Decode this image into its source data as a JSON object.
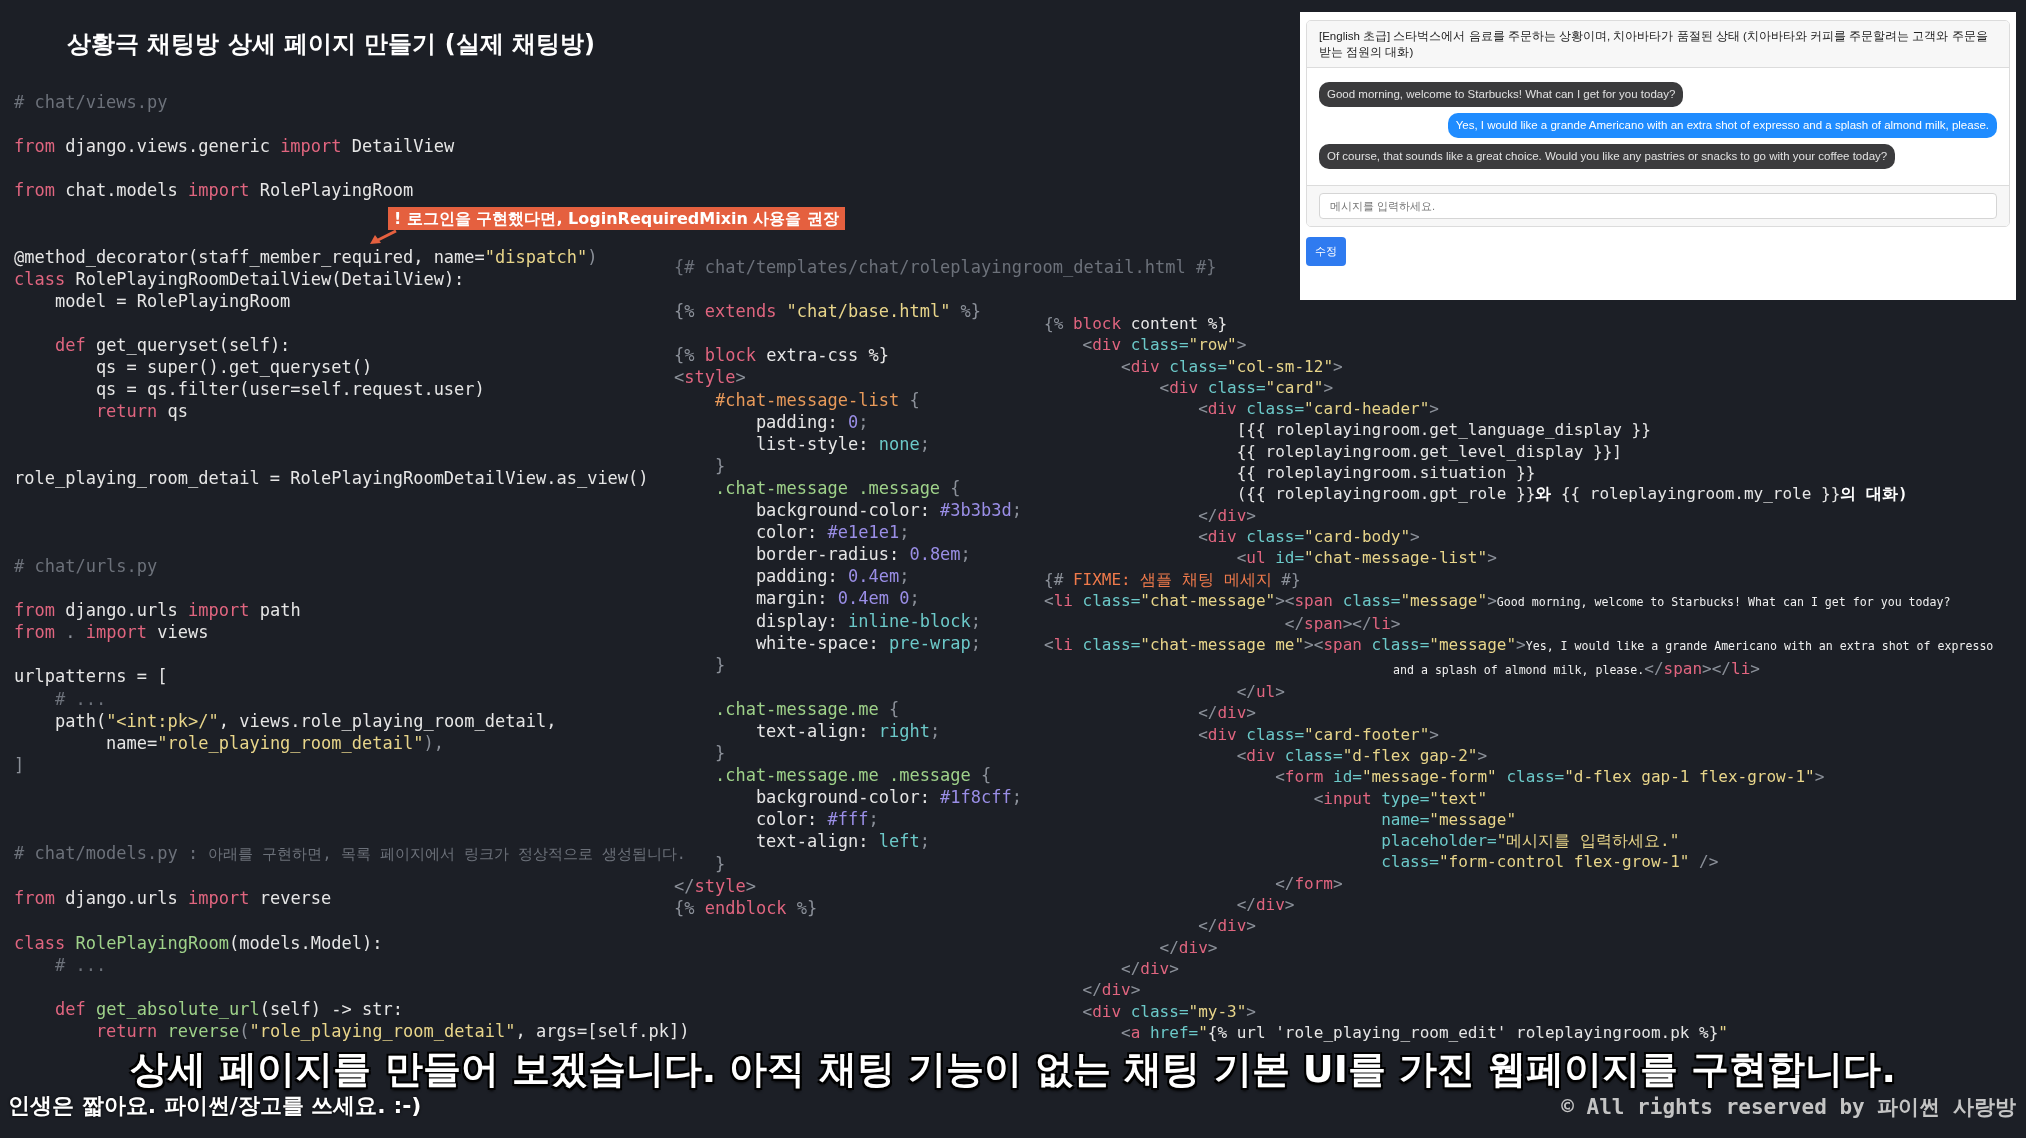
{
  "title": "상황극 채팅방 상세 페이지 만들기 (실제 채팅방)",
  "code_panes": [
    {
      "lines": [
        {
          "kind": "code",
          "tokens": [
            {
              "t": "# chat/views.py",
              "kind": "comment"
            }
          ]
        },
        {
          "kind": "blank"
        },
        {
          "kind": "code",
          "tokens": [
            {
              "t": "from",
              "kind": "keyword"
            },
            {
              "t": " django.views.generic ",
              "kind": "plain"
            },
            {
              "t": "import",
              "kind": "keyword"
            },
            {
              "t": " DetailView",
              "kind": "plain"
            }
          ]
        },
        {
          "kind": "blank"
        },
        {
          "kind": "code",
          "tokens": [
            {
              "t": "from",
              "kind": "keyword"
            },
            {
              "t": " chat.models ",
              "kind": "plain"
            },
            {
              "t": "import",
              "kind": "keyword"
            },
            {
              "t": " RolePlayingRoom",
              "kind": "plain"
            }
          ]
        },
        {
          "kind": "blank"
        },
        {
          "kind": "blank"
        },
        {
          "kind": "code",
          "tokens": [
            {
              "t": "@method_decorator(staff_member_required, name=",
              "kind": "plain"
            },
            {
              "t": "\"dispatch\"",
              "kind": "string"
            },
            {
              "t": ")",
              "kind": "punct"
            }
          ]
        },
        {
          "kind": "code",
          "tokens": [
            {
              "t": "class",
              "kind": "keyword"
            },
            {
              "t": " RolePlayingRoomDetailView(DetailView):",
              "kind": "plain"
            }
          ]
        },
        {
          "kind": "code",
          "tokens": [
            {
              "t": "    model = RolePlayingRoom",
              "kind": "plain"
            }
          ]
        },
        {
          "kind": "blank"
        },
        {
          "kind": "code",
          "tokens": [
            {
              "t": "    def",
              "kind": "keyword"
            },
            {
              "t": " get_queryset(self):",
              "kind": "plain"
            }
          ]
        },
        {
          "kind": "code",
          "tokens": [
            {
              "t": "        qs = super().get_queryset()",
              "kind": "plain"
            }
          ]
        },
        {
          "kind": "code",
          "tokens": [
            {
              "t": "        qs = qs.filter(user=self.request.user)",
              "kind": "plain"
            }
          ]
        },
        {
          "kind": "code",
          "tokens": [
            {
              "t": "        return",
              "kind": "keyword"
            },
            {
              "t": " qs",
              "kind": "plain"
            }
          ]
        },
        {
          "kind": "blank"
        },
        {
          "kind": "blank"
        },
        {
          "kind": "code",
          "tokens": [
            {
              "t": "role_playing_room_detail = RolePlayingRoomDetailView.as_view()",
              "kind": "plain"
            }
          ]
        },
        {
          "kind": "blank"
        },
        {
          "kind": "blank"
        },
        {
          "kind": "blank"
        },
        {
          "kind": "code",
          "tokens": [
            {
              "t": "# chat/urls.py",
              "kind": "comment"
            }
          ]
        },
        {
          "kind": "blank"
        },
        {
          "kind": "code",
          "tokens": [
            {
              "t": "from",
              "kind": "keyword"
            },
            {
              "t": " django.urls ",
              "kind": "plain"
            },
            {
              "t": "import",
              "kind": "keyword"
            },
            {
              "t": " path",
              "kind": "plain"
            }
          ]
        },
        {
          "kind": "code",
          "tokens": [
            {
              "t": "from",
              "kind": "keyword"
            },
            {
              "t": " . ",
              "kind": "punct"
            },
            {
              "t": "import",
              "kind": "keyword"
            },
            {
              "t": " views",
              "kind": "plain"
            }
          ]
        },
        {
          "kind": "blank"
        },
        {
          "kind": "code",
          "tokens": [
            {
              "t": "urlpatterns = [",
              "kind": "plain"
            }
          ]
        },
        {
          "kind": "code",
          "tokens": [
            {
              "t": "    # ...",
              "kind": "comment"
            }
          ]
        },
        {
          "kind": "code",
          "tokens": [
            {
              "t": "    path(",
              "kind": "plain"
            },
            {
              "t": "\"<int:pk>/\"",
              "kind": "string"
            },
            {
              "t": ", views.role_playing_room_detail,",
              "kind": "plain"
            }
          ]
        },
        {
          "kind": "code",
          "tokens": [
            {
              "t": "         name=",
              "kind": "plain"
            },
            {
              "t": "\"role_playing_room_detail\"",
              "kind": "string"
            },
            {
              "t": "),",
              "kind": "punct"
            }
          ]
        },
        {
          "kind": "code",
          "tokens": [
            {
              "t": "]",
              "kind": "punct"
            }
          ]
        },
        {
          "kind": "blank"
        },
        {
          "kind": "blank"
        },
        {
          "kind": "blank"
        },
        {
          "kind": "code",
          "tokens": [
            {
              "t": "# chat/models.py : ",
              "kind": "comment"
            },
            {
              "t": "아래를 구현하면, 목록 페이지에서 링크가 정상적으로 생성됩니다.",
              "kind": "comment-hangul"
            }
          ]
        },
        {
          "kind": "blank"
        },
        {
          "kind": "code",
          "tokens": [
            {
              "t": "from",
              "kind": "keyword"
            },
            {
              "t": " django.urls ",
              "kind": "plain"
            },
            {
              "t": "import",
              "kind": "keyword"
            },
            {
              "t": " reverse",
              "kind": "plain"
            }
          ]
        },
        {
          "kind": "blank"
        },
        {
          "kind": "code",
          "tokens": [
            {
              "t": "class",
              "kind": "keyword"
            },
            {
              "t": " RolePlayingRoom",
              "kind": "name"
            },
            {
              "t": "(models.Model):",
              "kind": "plain"
            }
          ]
        },
        {
          "kind": "code",
          "tokens": [
            {
              "t": "    # ...",
              "kind": "comment"
            }
          ]
        },
        {
          "kind": "blank"
        },
        {
          "kind": "code",
          "tokens": [
            {
              "t": "    def",
              "kind": "keyword"
            },
            {
              "t": " get_absolute_url",
              "kind": "name"
            },
            {
              "t": "(self) -> str:",
              "kind": "plain"
            }
          ]
        },
        {
          "kind": "code",
          "tokens": [
            {
              "t": "        return",
              "kind": "keyword"
            },
            {
              "t": " reverse",
              "kind": "name"
            },
            {
              "t": "(",
              "kind": "punct"
            },
            {
              "t": "\"role_playing_room_detail\"",
              "kind": "string"
            },
            {
              "t": ", args=[self.pk])",
              "kind": "plain"
            }
          ]
        }
      ]
    },
    {
      "lines": [
        {
          "kind": "code",
          "tokens": [
            {
              "t": "{# chat/templates/chat/roleplayingroom_detail.html #}",
              "kind": "comment"
            }
          ]
        },
        {
          "kind": "blank"
        },
        {
          "kind": "code",
          "tokens": [
            {
              "t": "{% ",
              "kind": "punct"
            },
            {
              "t": "extends",
              "kind": "keyword"
            },
            {
              "t": " \"chat/base.html\"",
              "kind": "string"
            },
            {
              "t": " %}",
              "kind": "punct"
            }
          ]
        },
        {
          "kind": "blank"
        },
        {
          "kind": "code",
          "tokens": [
            {
              "t": "{% ",
              "kind": "punct"
            },
            {
              "t": "block",
              "kind": "keyword"
            },
            {
              "t": " extra-css %}",
              "kind": "plain"
            }
          ]
        },
        {
          "kind": "code",
          "tokens": [
            {
              "t": "<",
              "kind": "punct"
            },
            {
              "t": "style",
              "kind": "keyword"
            },
            {
              "t": ">",
              "kind": "punct"
            }
          ]
        },
        {
          "kind": "code",
          "tokens": [
            {
              "t": "    #chat-message-list",
              "kind": "selector"
            },
            {
              "t": " {",
              "kind": "punct"
            }
          ]
        },
        {
          "kind": "code",
          "tokens": [
            {
              "t": "        padding: ",
              "kind": "plain"
            },
            {
              "t": "0",
              "kind": "number"
            },
            {
              "t": ";",
              "kind": "punct"
            }
          ]
        },
        {
          "kind": "code",
          "tokens": [
            {
              "t": "        list-style: ",
              "kind": "plain"
            },
            {
              "t": "none",
              "kind": "value"
            },
            {
              "t": ";",
              "kind": "punct"
            }
          ]
        },
        {
          "kind": "code",
          "tokens": [
            {
              "t": "    }",
              "kind": "punct"
            }
          ]
        },
        {
          "kind": "code",
          "tokens": [
            {
              "t": "    .chat-message .message",
              "kind": "name"
            },
            {
              "t": " {",
              "kind": "punct"
            }
          ]
        },
        {
          "kind": "code",
          "tokens": [
            {
              "t": "        background-color: ",
              "kind": "plain"
            },
            {
              "t": "#3b3b3d",
              "kind": "number"
            },
            {
              "t": ";",
              "kind": "punct"
            }
          ]
        },
        {
          "kind": "code",
          "tokens": [
            {
              "t": "        color: ",
              "kind": "plain"
            },
            {
              "t": "#e1e1e1",
              "kind": "number"
            },
            {
              "t": ";",
              "kind": "punct"
            }
          ]
        },
        {
          "kind": "code",
          "tokens": [
            {
              "t": "        border-radius: ",
              "kind": "plain"
            },
            {
              "t": "0.8em",
              "kind": "number"
            },
            {
              "t": ";",
              "kind": "punct"
            }
          ]
        },
        {
          "kind": "code",
          "tokens": [
            {
              "t": "        padding: ",
              "kind": "plain"
            },
            {
              "t": "0.4em",
              "kind": "number"
            },
            {
              "t": ";",
              "kind": "punct"
            }
          ]
        },
        {
          "kind": "code",
          "tokens": [
            {
              "t": "        margin: ",
              "kind": "plain"
            },
            {
              "t": "0.4em 0",
              "kind": "number"
            },
            {
              "t": ";",
              "kind": "punct"
            }
          ]
        },
        {
          "kind": "code",
          "tokens": [
            {
              "t": "        display: ",
              "kind": "plain"
            },
            {
              "t": "inline-block",
              "kind": "value"
            },
            {
              "t": ";",
              "kind": "punct"
            }
          ]
        },
        {
          "kind": "code",
          "tokens": [
            {
              "t": "        white-space: ",
              "kind": "plain"
            },
            {
              "t": "pre-wrap",
              "kind": "value"
            },
            {
              "t": ";",
              "kind": "punct"
            }
          ]
        },
        {
          "kind": "code",
          "tokens": [
            {
              "t": "    }",
              "kind": "punct"
            }
          ]
        },
        {
          "kind": "blank"
        },
        {
          "kind": "code",
          "tokens": [
            {
              "t": "    .chat-message.me",
              "kind": "name"
            },
            {
              "t": " {",
              "kind": "punct"
            }
          ]
        },
        {
          "kind": "code",
          "tokens": [
            {
              "t": "        text-align: ",
              "kind": "plain"
            },
            {
              "t": "right",
              "kind": "value"
            },
            {
              "t": ";",
              "kind": "punct"
            }
          ]
        },
        {
          "kind": "code",
          "tokens": [
            {
              "t": "    }",
              "kind": "punct"
            }
          ]
        },
        {
          "kind": "code",
          "tokens": [
            {
              "t": "    .chat-message.me .message",
              "kind": "name"
            },
            {
              "t": " {",
              "kind": "punct"
            }
          ]
        },
        {
          "kind": "code",
          "tokens": [
            {
              "t": "        background-color: ",
              "kind": "plain"
            },
            {
              "t": "#1f8cff",
              "kind": "number"
            },
            {
              "t": ";",
              "kind": "punct"
            }
          ]
        },
        {
          "kind": "code",
          "tokens": [
            {
              "t": "        color: ",
              "kind": "plain"
            },
            {
              "t": "#fff",
              "kind": "number"
            },
            {
              "t": ";",
              "kind": "punct"
            }
          ]
        },
        {
          "kind": "code",
          "tokens": [
            {
              "t": "        text-align: ",
              "kind": "plain"
            },
            {
              "t": "left",
              "kind": "value"
            },
            {
              "t": ";",
              "kind": "punct"
            }
          ]
        },
        {
          "kind": "code",
          "tokens": [
            {
              "t": "    }",
              "kind": "punct"
            }
          ]
        },
        {
          "kind": "code",
          "tokens": [
            {
              "t": "</",
              "kind": "punct"
            },
            {
              "t": "style",
              "kind": "keyword"
            },
            {
              "t": ">",
              "kind": "punct"
            }
          ]
        },
        {
          "kind": "code",
          "tokens": [
            {
              "t": "{% ",
              "kind": "punct"
            },
            {
              "t": "endblock",
              "kind": "keyword"
            },
            {
              "t": " %}",
              "kind": "punct"
            }
          ]
        }
      ]
    },
    {
      "lines": [
        {
          "kind": "code",
          "tokens": [
            {
              "t": "{% ",
              "kind": "punct"
            },
            {
              "t": "block",
              "kind": "keyword"
            },
            {
              "t": " content %}",
              "kind": "plain"
            }
          ]
        },
        {
          "kind": "code",
          "tokens": [
            {
              "t": "    <",
              "kind": "punct"
            },
            {
              "t": "div",
              "kind": "keyword"
            },
            {
              "t": " class=",
              "kind": "value"
            },
            {
              "t": "\"row\"",
              "kind": "string"
            },
            {
              "t": ">",
              "kind": "punct"
            }
          ]
        },
        {
          "kind": "code",
          "tokens": [
            {
              "t": "        <",
              "kind": "punct"
            },
            {
              "t": "div",
              "kind": "keyword"
            },
            {
              "t": " class=",
              "kind": "value"
            },
            {
              "t": "\"col-sm-12\"",
              "kind": "string"
            },
            {
              "t": ">",
              "kind": "punct"
            }
          ]
        },
        {
          "kind": "code",
          "tokens": [
            {
              "t": "            <",
              "kind": "punct"
            },
            {
              "t": "div",
              "kind": "keyword"
            },
            {
              "t": " class=",
              "kind": "value"
            },
            {
              "t": "\"card\"",
              "kind": "string"
            },
            {
              "t": ">",
              "kind": "punct"
            }
          ]
        },
        {
          "kind": "code",
          "tokens": [
            {
              "t": "                <",
              "kind": "punct"
            },
            {
              "t": "div",
              "kind": "keyword"
            },
            {
              "t": " class=",
              "kind": "value"
            },
            {
              "t": "\"card-header\"",
              "kind": "string"
            },
            {
              "t": ">",
              "kind": "punct"
            }
          ]
        },
        {
          "kind": "code",
          "tokens": [
            {
              "t": "                    [{{ roleplayingroom.get_language_display }}",
              "kind": "plain"
            }
          ]
        },
        {
          "kind": "code",
          "tokens": [
            {
              "t": "                    {{ roleplayingroom.get_level_display }}]",
              "kind": "plain"
            }
          ]
        },
        {
          "kind": "code",
          "tokens": [
            {
              "t": "                    {{ roleplayingroom.situation }}",
              "kind": "plain"
            }
          ]
        },
        {
          "kind": "code",
          "tokens": [
            {
              "t": "                    ({{ roleplayingroom.gpt_role }}",
              "kind": "plain"
            },
            {
              "t": "와 ",
              "kind": "hangul"
            },
            {
              "t": "{{ roleplayingroom.my_role }}",
              "kind": "plain"
            },
            {
              "t": "의 대화)",
              "kind": "hangul"
            }
          ]
        },
        {
          "kind": "code",
          "tokens": [
            {
              "t": "                </",
              "kind": "punct"
            },
            {
              "t": "div",
              "kind": "keyword"
            },
            {
              "t": ">",
              "kind": "punct"
            }
          ]
        },
        {
          "kind": "code",
          "tokens": [
            {
              "t": "                <",
              "kind": "punct"
            },
            {
              "t": "div",
              "kind": "keyword"
            },
            {
              "t": " class=",
              "kind": "value"
            },
            {
              "t": "\"card-body\"",
              "kind": "string"
            },
            {
              "t": ">",
              "kind": "punct"
            }
          ]
        },
        {
          "kind": "code",
          "tokens": [
            {
              "t": "                    <",
              "kind": "punct"
            },
            {
              "t": "ul",
              "kind": "keyword"
            },
            {
              "t": " id=",
              "kind": "value"
            },
            {
              "t": "\"chat-message-list\"",
              "kind": "string"
            },
            {
              "t": ">",
              "kind": "punct"
            }
          ]
        },
        {
          "kind": "code",
          "tokens": [
            {
              "t": "{# ",
              "kind": "punct"
            },
            {
              "t": "FIXME: 샘플 채팅 메세지",
              "kind": "fixme"
            },
            {
              "t": " #}",
              "kind": "punct"
            }
          ]
        },
        {
          "kind": "code",
          "tokens": [
            {
              "t": "<",
              "kind": "punct"
            },
            {
              "t": "li",
              "kind": "keyword"
            },
            {
              "t": " class=",
              "kind": "value"
            },
            {
              "t": "\"chat-message\"",
              "kind": "string"
            },
            {
              "t": "><",
              "kind": "punct"
            },
            {
              "t": "span",
              "kind": "keyword"
            },
            {
              "t": " class=",
              "kind": "value"
            },
            {
              "t": "\"message\"",
              "kind": "string"
            },
            {
              "t": ">",
              "kind": "punct"
            },
            {
              "t": "Good morning, welcome to Starbucks! What can I get for you today?",
              "kind": "message"
            }
          ]
        },
        {
          "kind": "code",
          "tokens": [
            {
              "t": "                         </",
              "kind": "punct"
            },
            {
              "t": "span",
              "kind": "keyword"
            },
            {
              "t": "></",
              "kind": "punct"
            },
            {
              "t": "li",
              "kind": "keyword"
            },
            {
              "t": ">",
              "kind": "punct"
            }
          ]
        },
        {
          "kind": "code",
          "tokens": [
            {
              "t": "<",
              "kind": "punct"
            },
            {
              "t": "li",
              "kind": "keyword"
            },
            {
              "t": " class=",
              "kind": "value"
            },
            {
              "t": "\"chat-message me\"",
              "kind": "string"
            },
            {
              "t": "><",
              "kind": "punct"
            },
            {
              "t": "span",
              "kind": "keyword"
            },
            {
              "t": " class=",
              "kind": "value"
            },
            {
              "t": "\"message\"",
              "kind": "string"
            },
            {
              "t": ">",
              "kind": "punct"
            },
            {
              "t": "Yes, I would like a grande Americano with an extra shot of expresso",
              "kind": "message"
            }
          ]
        },
        {
          "kind": "code",
          "tokens": [
            {
              "t": "                                                  and a splash of almond milk, please.",
              "kind": "message-indented"
            },
            {
              "t": "</",
              "kind": "punct"
            },
            {
              "t": "span",
              "kind": "keyword"
            },
            {
              "t": "></",
              "kind": "punct"
            },
            {
              "t": "li",
              "kind": "keyword"
            },
            {
              "t": ">",
              "kind": "punct"
            }
          ]
        },
        {
          "kind": "code",
          "tokens": [
            {
              "t": "                    </",
              "kind": "punct"
            },
            {
              "t": "ul",
              "kind": "keyword"
            },
            {
              "t": ">",
              "kind": "punct"
            }
          ]
        },
        {
          "kind": "code",
          "tokens": [
            {
              "t": "                </",
              "kind": "punct"
            },
            {
              "t": "div",
              "kind": "keyword"
            },
            {
              "t": ">",
              "kind": "punct"
            }
          ]
        },
        {
          "kind": "code",
          "tokens": [
            {
              "t": "                <",
              "kind": "punct"
            },
            {
              "t": "div",
              "kind": "keyword"
            },
            {
              "t": " class=",
              "kind": "value"
            },
            {
              "t": "\"card-footer\"",
              "kind": "string"
            },
            {
              "t": ">",
              "kind": "punct"
            }
          ]
        },
        {
          "kind": "code",
          "tokens": [
            {
              "t": "                    <",
              "kind": "punct"
            },
            {
              "t": "div",
              "kind": "keyword"
            },
            {
              "t": " class=",
              "kind": "value"
            },
            {
              "t": "\"d-flex gap-2\"",
              "kind": "string"
            },
            {
              "t": ">",
              "kind": "punct"
            }
          ]
        },
        {
          "kind": "code",
          "tokens": [
            {
              "t": "                        <",
              "kind": "punct"
            },
            {
              "t": "form",
              "kind": "keyword"
            },
            {
              "t": " id=",
              "kind": "value"
            },
            {
              "t": "\"message-form\"",
              "kind": "string"
            },
            {
              "t": " class=",
              "kind": "value"
            },
            {
              "t": "\"d-flex gap-1 flex-grow-1\"",
              "kind": "string"
            },
            {
              "t": ">",
              "kind": "punct"
            }
          ]
        },
        {
          "kind": "code",
          "tokens": [
            {
              "t": "                            <",
              "kind": "punct"
            },
            {
              "t": "input",
              "kind": "keyword"
            },
            {
              "t": " type=",
              "kind": "value"
            },
            {
              "t": "\"text\"",
              "kind": "string"
            }
          ]
        },
        {
          "kind": "code",
          "tokens": [
            {
              "t": "                                   name=",
              "kind": "value"
            },
            {
              "t": "\"message\"",
              "kind": "string"
            }
          ]
        },
        {
          "kind": "code",
          "tokens": [
            {
              "t": "                                   placeholder=",
              "kind": "value"
            },
            {
              "t": "\"메시지를 입력하세요.\"",
              "kind": "string"
            }
          ]
        },
        {
          "kind": "code",
          "tokens": [
            {
              "t": "                                   class=",
              "kind": "value"
            },
            {
              "t": "\"form-control flex-grow-1\"",
              "kind": "string"
            },
            {
              "t": " />",
              "kind": "punct"
            }
          ]
        },
        {
          "kind": "code",
          "tokens": [
            {
              "t": "                        </",
              "kind": "punct"
            },
            {
              "t": "form",
              "kind": "keyword"
            },
            {
              "t": ">",
              "kind": "punct"
            }
          ]
        },
        {
          "kind": "code",
          "tokens": [
            {
              "t": "                    </",
              "kind": "punct"
            },
            {
              "t": "div",
              "kind": "keyword"
            },
            {
              "t": ">",
              "kind": "punct"
            }
          ]
        },
        {
          "kind": "code",
          "tokens": [
            {
              "t": "                </",
              "kind": "punct"
            },
            {
              "t": "div",
              "kind": "keyword"
            },
            {
              "t": ">",
              "kind": "punct"
            }
          ]
        },
        {
          "kind": "code",
          "tokens": [
            {
              "t": "            </",
              "kind": "punct"
            },
            {
              "t": "div",
              "kind": "keyword"
            },
            {
              "t": ">",
              "kind": "punct"
            }
          ]
        },
        {
          "kind": "code",
          "tokens": [
            {
              "t": "        </",
              "kind": "punct"
            },
            {
              "t": "div",
              "kind": "keyword"
            },
            {
              "t": ">",
              "kind": "punct"
            }
          ]
        },
        {
          "kind": "code",
          "tokens": [
            {
              "t": "    </",
              "kind": "punct"
            },
            {
              "t": "div",
              "kind": "keyword"
            },
            {
              "t": ">",
              "kind": "punct"
            }
          ]
        },
        {
          "kind": "code",
          "tokens": [
            {
              "t": "    <",
              "kind": "punct"
            },
            {
              "t": "div",
              "kind": "keyword"
            },
            {
              "t": " class=",
              "kind": "value"
            },
            {
              "t": "\"my-3\"",
              "kind": "string"
            },
            {
              "t": ">",
              "kind": "punct"
            }
          ]
        },
        {
          "kind": "code",
          "tokens": [
            {
              "t": "        <",
              "kind": "punct"
            },
            {
              "t": "a",
              "kind": "keyword"
            },
            {
              "t": " href=",
              "kind": "value"
            },
            {
              "t": "\"",
              "kind": "string"
            },
            {
              "t": "{% url 'role_playing_room_edit' roleplayingroom.pk %}",
              "kind": "plain"
            },
            {
              "t": "\"",
              "kind": "string"
            }
          ]
        }
      ]
    }
  ],
  "callout": {
    "text": "! 로그인을 구현했다면, LoginRequiredMixin 사용을 권장"
  },
  "preview": {
    "header": "[English 초급] 스타벅스에서 음료를 주문하는 상황이며, 치아바타가 품절된 상태 (치아바타와 커피를 주문할려는 고객와 주문을 받는 점원의 대화)",
    "messages": [
      {
        "text": "Good morning, welcome to Starbucks! What can I get for you today?",
        "mine": false
      },
      {
        "text": "Yes, I would like a grande Americano with an extra shot of expresso and a splash of almond milk, please.",
        "mine": true
      },
      {
        "text": "Of course, that sounds like a great choice. Would you like any pastries or snacks to go with your coffee today?",
        "mine": false
      }
    ],
    "input": {
      "placeholder": "메시지를 입력하세요."
    },
    "button": "수정"
  },
  "subtitle": "상세 페이지를 만들어 보겠습니다. 아직 채팅 기능이 없는 채팅 기본 UI를 가진 웹페이지를 구현합니다.",
  "footer": {
    "slogan": "인생은 짧아요. 파이썬/장고를 쓰세요. :-)",
    "copyright": "© All rights reserved by 파이썬 사랑방"
  }
}
